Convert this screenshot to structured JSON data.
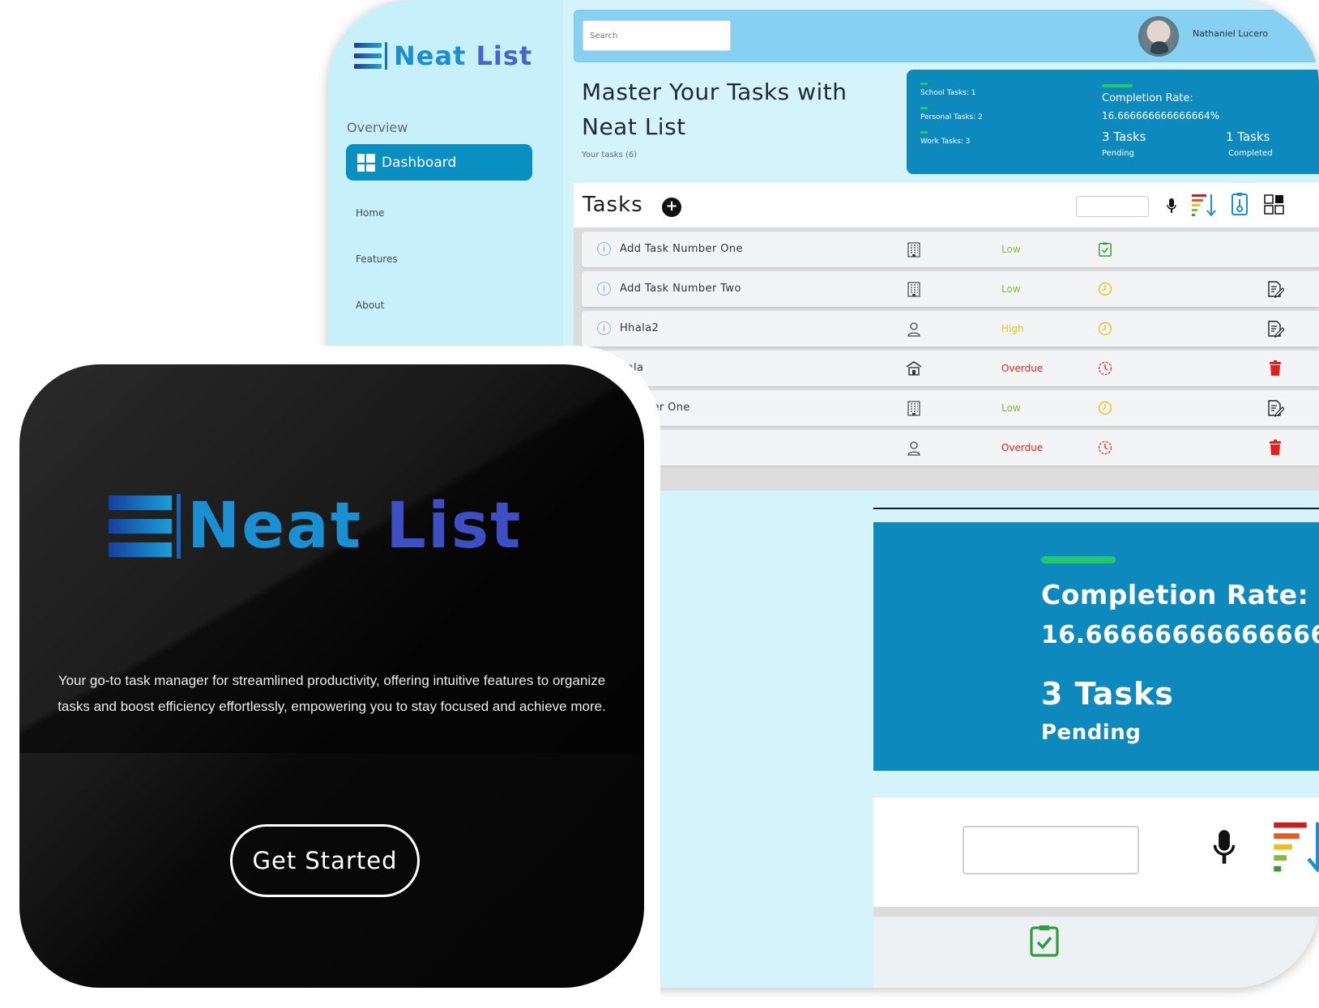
{
  "brand": {
    "name_part1": "Neat",
    "name_part2": "List"
  },
  "sidebar": {
    "section_label": "Overview",
    "active_item": "Dashboard",
    "links": [
      "Home",
      "Features",
      "About"
    ]
  },
  "topbar": {
    "search_placeholder": "Search",
    "username": "Nathaniel Lucero"
  },
  "hero": {
    "title_line1": "Master Your Tasks with",
    "title_line2": "Neat List",
    "subtitle": "Your tasks (6)"
  },
  "stats": {
    "school": "School Tasks: 1",
    "personal": "Personal Tasks: 2",
    "work": "Work Tasks: 3",
    "completion_label": "Completion Rate:",
    "completion_value": "16.666666666666664%",
    "pending_count": "3 Tasks",
    "pending_label": "Pending",
    "completed_count": "1 Tasks",
    "completed_label": "Completed"
  },
  "tasks": {
    "title": "Tasks",
    "add_symbol": "+",
    "rows": [
      {
        "name": "Add Task Number One",
        "category_icon": "office-building-icon",
        "priority": "Low",
        "priority_class": "p-low",
        "status": "completed",
        "action": "none"
      },
      {
        "name": "Add Task Number Two",
        "category_icon": "office-building-icon",
        "priority": "Low",
        "priority_class": "p-low",
        "status": "pending",
        "action": "edit"
      },
      {
        "name": "Hhala2",
        "category_icon": "person-icon",
        "priority": "High",
        "priority_class": "p-high",
        "status": "pending",
        "action": "edit"
      },
      {
        "name": "hala",
        "category_icon": "school-icon",
        "priority": "Overdue",
        "priority_class": "p-over",
        "status": "overdue",
        "action": "delete"
      },
      {
        "name": "Number One",
        "category_icon": "office-building-icon",
        "priority": "Low",
        "priority_class": "p-low",
        "status": "pending",
        "action": "edit"
      },
      {
        "name": "",
        "category_icon": "person-icon",
        "priority": "Overdue",
        "priority_class": "p-over",
        "status": "overdue",
        "action": "delete"
      }
    ]
  },
  "landing": {
    "logo_part1": "Neat",
    "logo_part2": "List",
    "description": "Your go-to task manager for streamlined productivity, offering intuitive features to organize tasks and boost efficiency effortlessly, empowering you to stay focused and achieve more.",
    "cta": "Get Started"
  },
  "colors": {
    "accent": "#0d89be",
    "sidebar": "#c8f0fb",
    "progress": "#23c86a",
    "low": "#7dbd3a",
    "high": "#e8c21c",
    "overdue": "#e0231c"
  }
}
